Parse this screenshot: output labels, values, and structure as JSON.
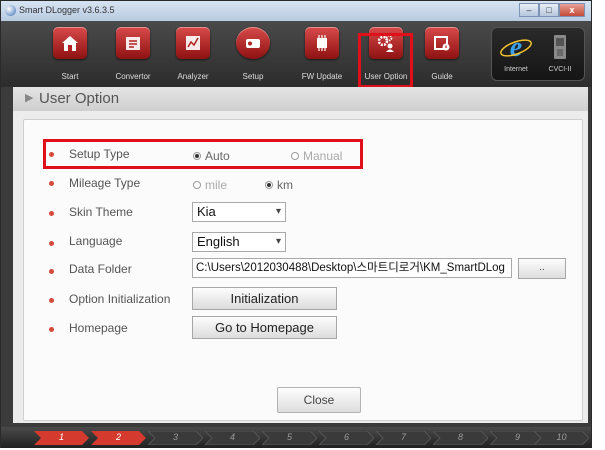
{
  "window": {
    "title": "Smart DLogger v3.6.3.5"
  },
  "toolbar": {
    "buttons": [
      {
        "id": "start",
        "label": "Start",
        "icon": "home-icon"
      },
      {
        "id": "convertor",
        "label": "Convertor",
        "icon": "convertor-icon"
      },
      {
        "id": "analyzer",
        "label": "Analyzer",
        "icon": "analyzer-icon"
      },
      {
        "id": "setup",
        "label": "Setup",
        "icon": "setup-icon"
      },
      {
        "id": "fw-update",
        "label": "FW Update",
        "icon": "chip-icon"
      },
      {
        "id": "user-option",
        "label": "User Option",
        "icon": "user-gear-icon"
      },
      {
        "id": "guide",
        "label": "Guide",
        "icon": "guide-icon"
      }
    ],
    "side": [
      {
        "label": "Internet",
        "icon": "internet-explorer-icon"
      },
      {
        "label": "CVCI-II",
        "icon": "cvci-device-icon"
      }
    ]
  },
  "page": {
    "title": "User Option"
  },
  "options": {
    "setup_type": {
      "label": "Setup Type",
      "choices": [
        "Auto",
        "Manual"
      ],
      "selected": "Auto"
    },
    "mileage_type": {
      "label": "Mileage Type",
      "choices": [
        "mile",
        "km"
      ],
      "selected": "km"
    },
    "skin_theme": {
      "label": "Skin Theme",
      "value": "Kia"
    },
    "language": {
      "label": "Language",
      "value": "English"
    },
    "data_folder": {
      "label": "Data Folder",
      "value": "C:\\Users\\2012030488\\Desktop\\스마트디로거\\KM_SmartDLog",
      "browse_label": ".."
    },
    "option_initialization": {
      "label": "Option Initialization",
      "button_label": "Initialization"
    },
    "homepage": {
      "label": "Homepage",
      "button_label": "Go to Homepage"
    }
  },
  "close_label": "Close",
  "steps": [
    {
      "label": "1",
      "active": true
    },
    {
      "label": "2",
      "active": true
    },
    {
      "label": "3",
      "active": false
    },
    {
      "label": "4",
      "active": false
    },
    {
      "label": "5",
      "active": false
    },
    {
      "label": "6",
      "active": false
    },
    {
      "label": "7",
      "active": false
    },
    {
      "label": "8",
      "active": false
    },
    {
      "label": "9",
      "active": false
    },
    {
      "label": "10",
      "active": false
    }
  ],
  "colors": {
    "accent_red": "#d7493a",
    "highlight": "#e0101a"
  }
}
